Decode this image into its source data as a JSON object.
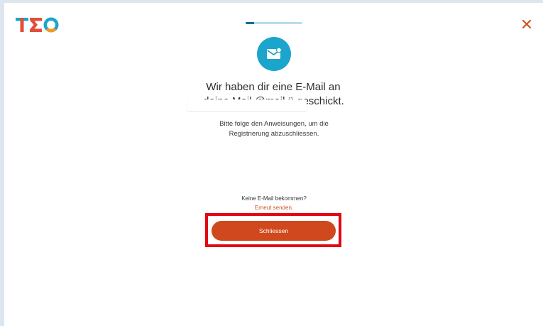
{
  "header": {
    "logo_text": "TEO",
    "close_icon": "close-icon"
  },
  "progress": {
    "fraction": 0.15,
    "color_track": "#b9dced",
    "color_fill": "#0d6f93"
  },
  "mail_icon": {
    "icon": "envelope-icon",
    "bg_color": "#1ba5cd"
  },
  "heading": {
    "line1": "Wir haben dir eine E-Mail an",
    "line2": "deine.Mail.@mail.ü geschickt."
  },
  "instructions": {
    "line1": "Bitte folge den Anweisungen, um die",
    "line2": "Registrierung abzuschliessen."
  },
  "footer": {
    "no_email_text": "Keine E-Mail bekommen?",
    "resend_label": "Erneut senden.",
    "close_button_label": "Schliessen"
  },
  "colors": {
    "accent": "#d0481d",
    "highlight": "#e30613"
  }
}
